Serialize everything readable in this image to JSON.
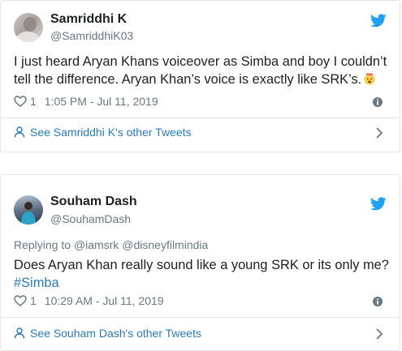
{
  "tweets": [
    {
      "name": "Samriddhi K",
      "handle": "@SamriddhiK03",
      "reply_prefix": "",
      "reply_mentions": "",
      "text_main": "I just heard Aryan Khans voiceover as Simba and boy I couldn’t tell the difference. Aryan Khan’s voice is exactly like SRK’s.",
      "hashtag": "",
      "emoji": "astonished-face-exploding-head",
      "likes": "1",
      "timestamp": "1:05 PM - Jul 11, 2019",
      "see_more": "See Samriddhi K's other Tweets"
    },
    {
      "name": "Souham Dash",
      "handle": "@SouhamDash",
      "reply_prefix": "Replying to",
      "reply_mentions": "@iamsrk @disneyfilmindia",
      "text_main": "Does Aryan Khan really sound like a young SRK or its only me?",
      "hashtag": "#Simba",
      "emoji": "",
      "likes": "1",
      "timestamp": "10:29 AM - Jul 11, 2019",
      "see_more": "See Souham Dash's other Tweets"
    }
  ],
  "colors": {
    "twitter_blue": "#1da1f2",
    "link_blue": "#2b7bb9",
    "text": "#1c2022",
    "muted": "#697882",
    "border": "#e1e8ed"
  },
  "icons": [
    "twitter-bird-icon",
    "heart-icon",
    "info-icon",
    "person-icon",
    "chevron-right-icon"
  ]
}
